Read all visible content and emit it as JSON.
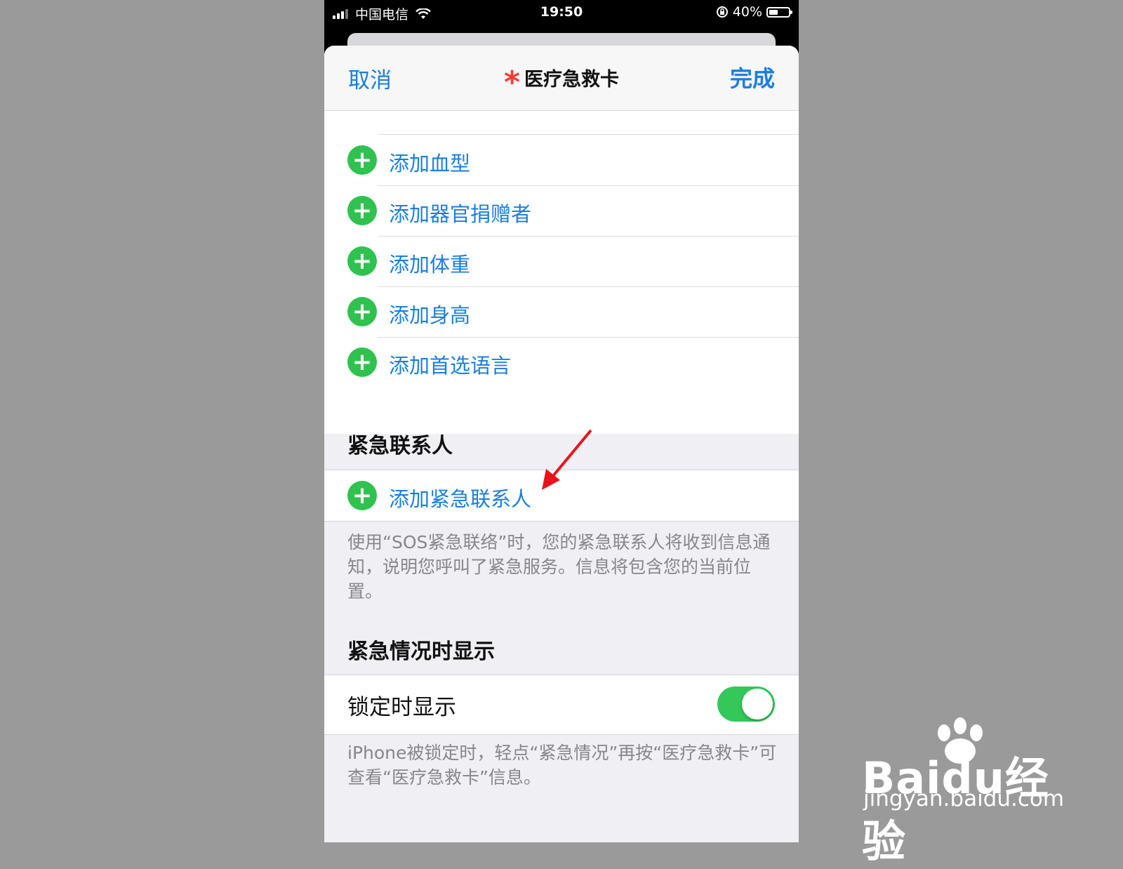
{
  "status_bar": {
    "carrier": "中国电信",
    "time": "19:50",
    "battery": "40%"
  },
  "nav": {
    "cancel": "取消",
    "title": "医疗急救卡",
    "done": "完成"
  },
  "add_items": [
    {
      "label": "添加血型"
    },
    {
      "label": "添加器官捐赠者"
    },
    {
      "label": "添加体重"
    },
    {
      "label": "添加身高"
    },
    {
      "label": "添加首选语言"
    }
  ],
  "emergency_contacts": {
    "header": "紧急联系人",
    "add_label": "添加紧急联系人",
    "footer": "使用“SOS紧急联络”时，您的紧急联系人将收到信息通知，说明您呼叫了紧急服务。信息将包含您的当前位置。"
  },
  "show_when_locked": {
    "header": "紧急情况时显示",
    "label": "锁定时显示",
    "enabled": true,
    "footer": "iPhone被锁定时，轻点“紧急情况”再按“医疗急救卡”可查看“医疗急救卡”信息。"
  },
  "watermark": {
    "brand": "Baidu经验",
    "url": "jingyan.baidu.com"
  },
  "colors": {
    "accent": "#1a7ee0",
    "add_green": "#2fc24f",
    "toggle_on": "#34c759",
    "annotation_arrow": "#e8141c"
  }
}
